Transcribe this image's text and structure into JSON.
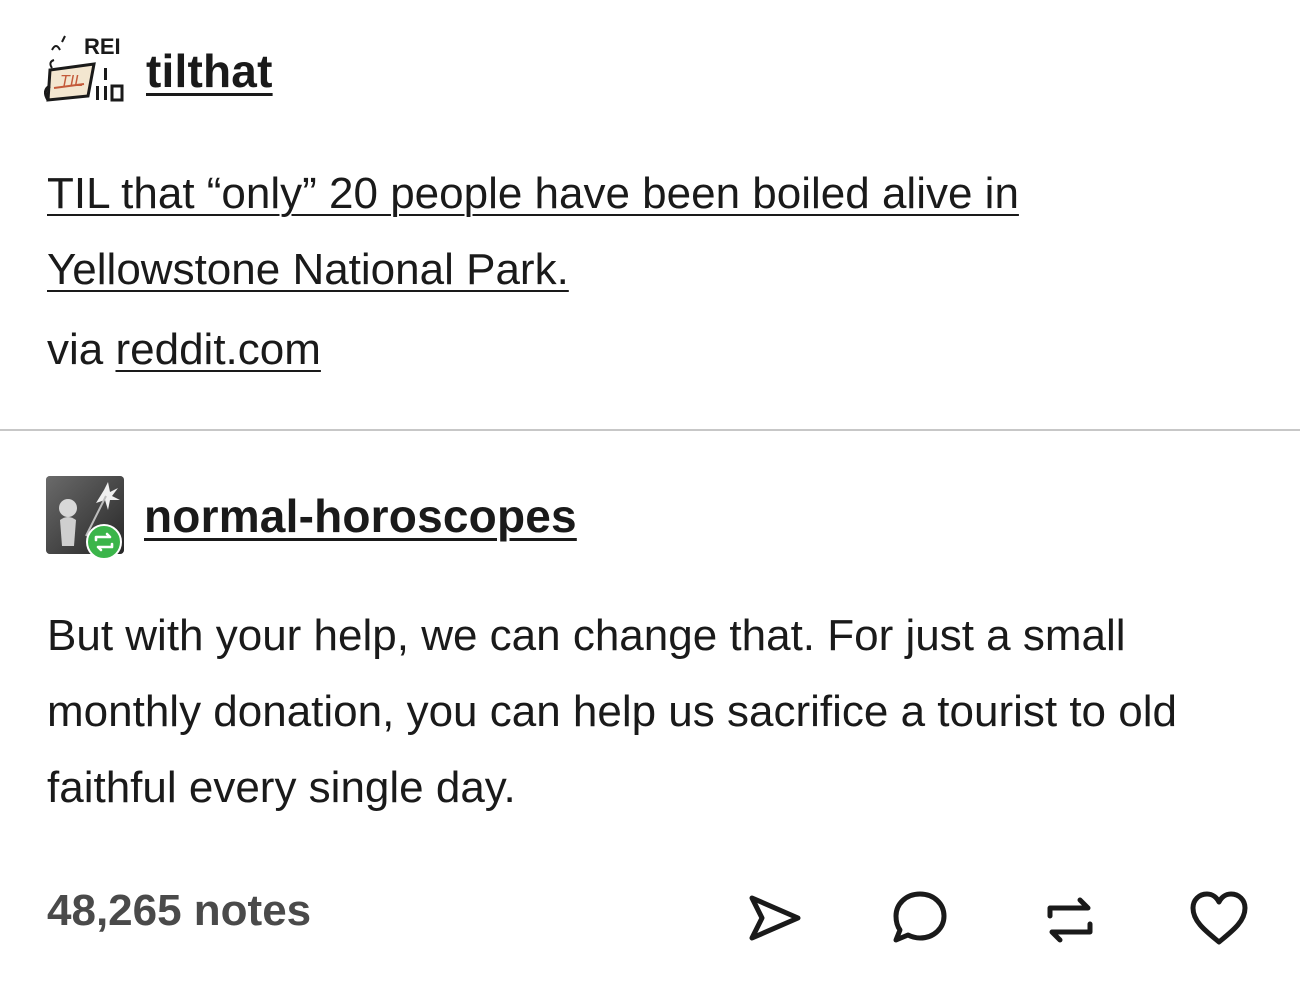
{
  "post1": {
    "blog_name": "tilthat",
    "avatar": {
      "icon": "til-reddit-avatar",
      "label_top": "REI",
      "label_badge": "TIL"
    },
    "title": "TIL that “only” 20 people have been boiled alive in Yellowstone National Park.",
    "via_prefix": "via",
    "via_link": "reddit.com"
  },
  "post2": {
    "blog_name": "normal-horoscopes",
    "avatar": {
      "icon": "horoscope-avatar",
      "badge_icon": "reblog-badge-icon",
      "badge_color": "#3bb54a"
    },
    "body": "But with your help, we can change that. For just a small monthly donation, you can help us sacrifice a tourist to old faithful every single day."
  },
  "footer": {
    "notes": "48,265 notes",
    "actions": [
      "share-icon",
      "reply-icon",
      "reblog-icon",
      "heart-icon"
    ]
  },
  "colors": {
    "text": "#1a1a1a",
    "notes_text": "#4a4a4a",
    "divider": "#c7c7c7",
    "reblog_badge": "#3bb54a"
  }
}
